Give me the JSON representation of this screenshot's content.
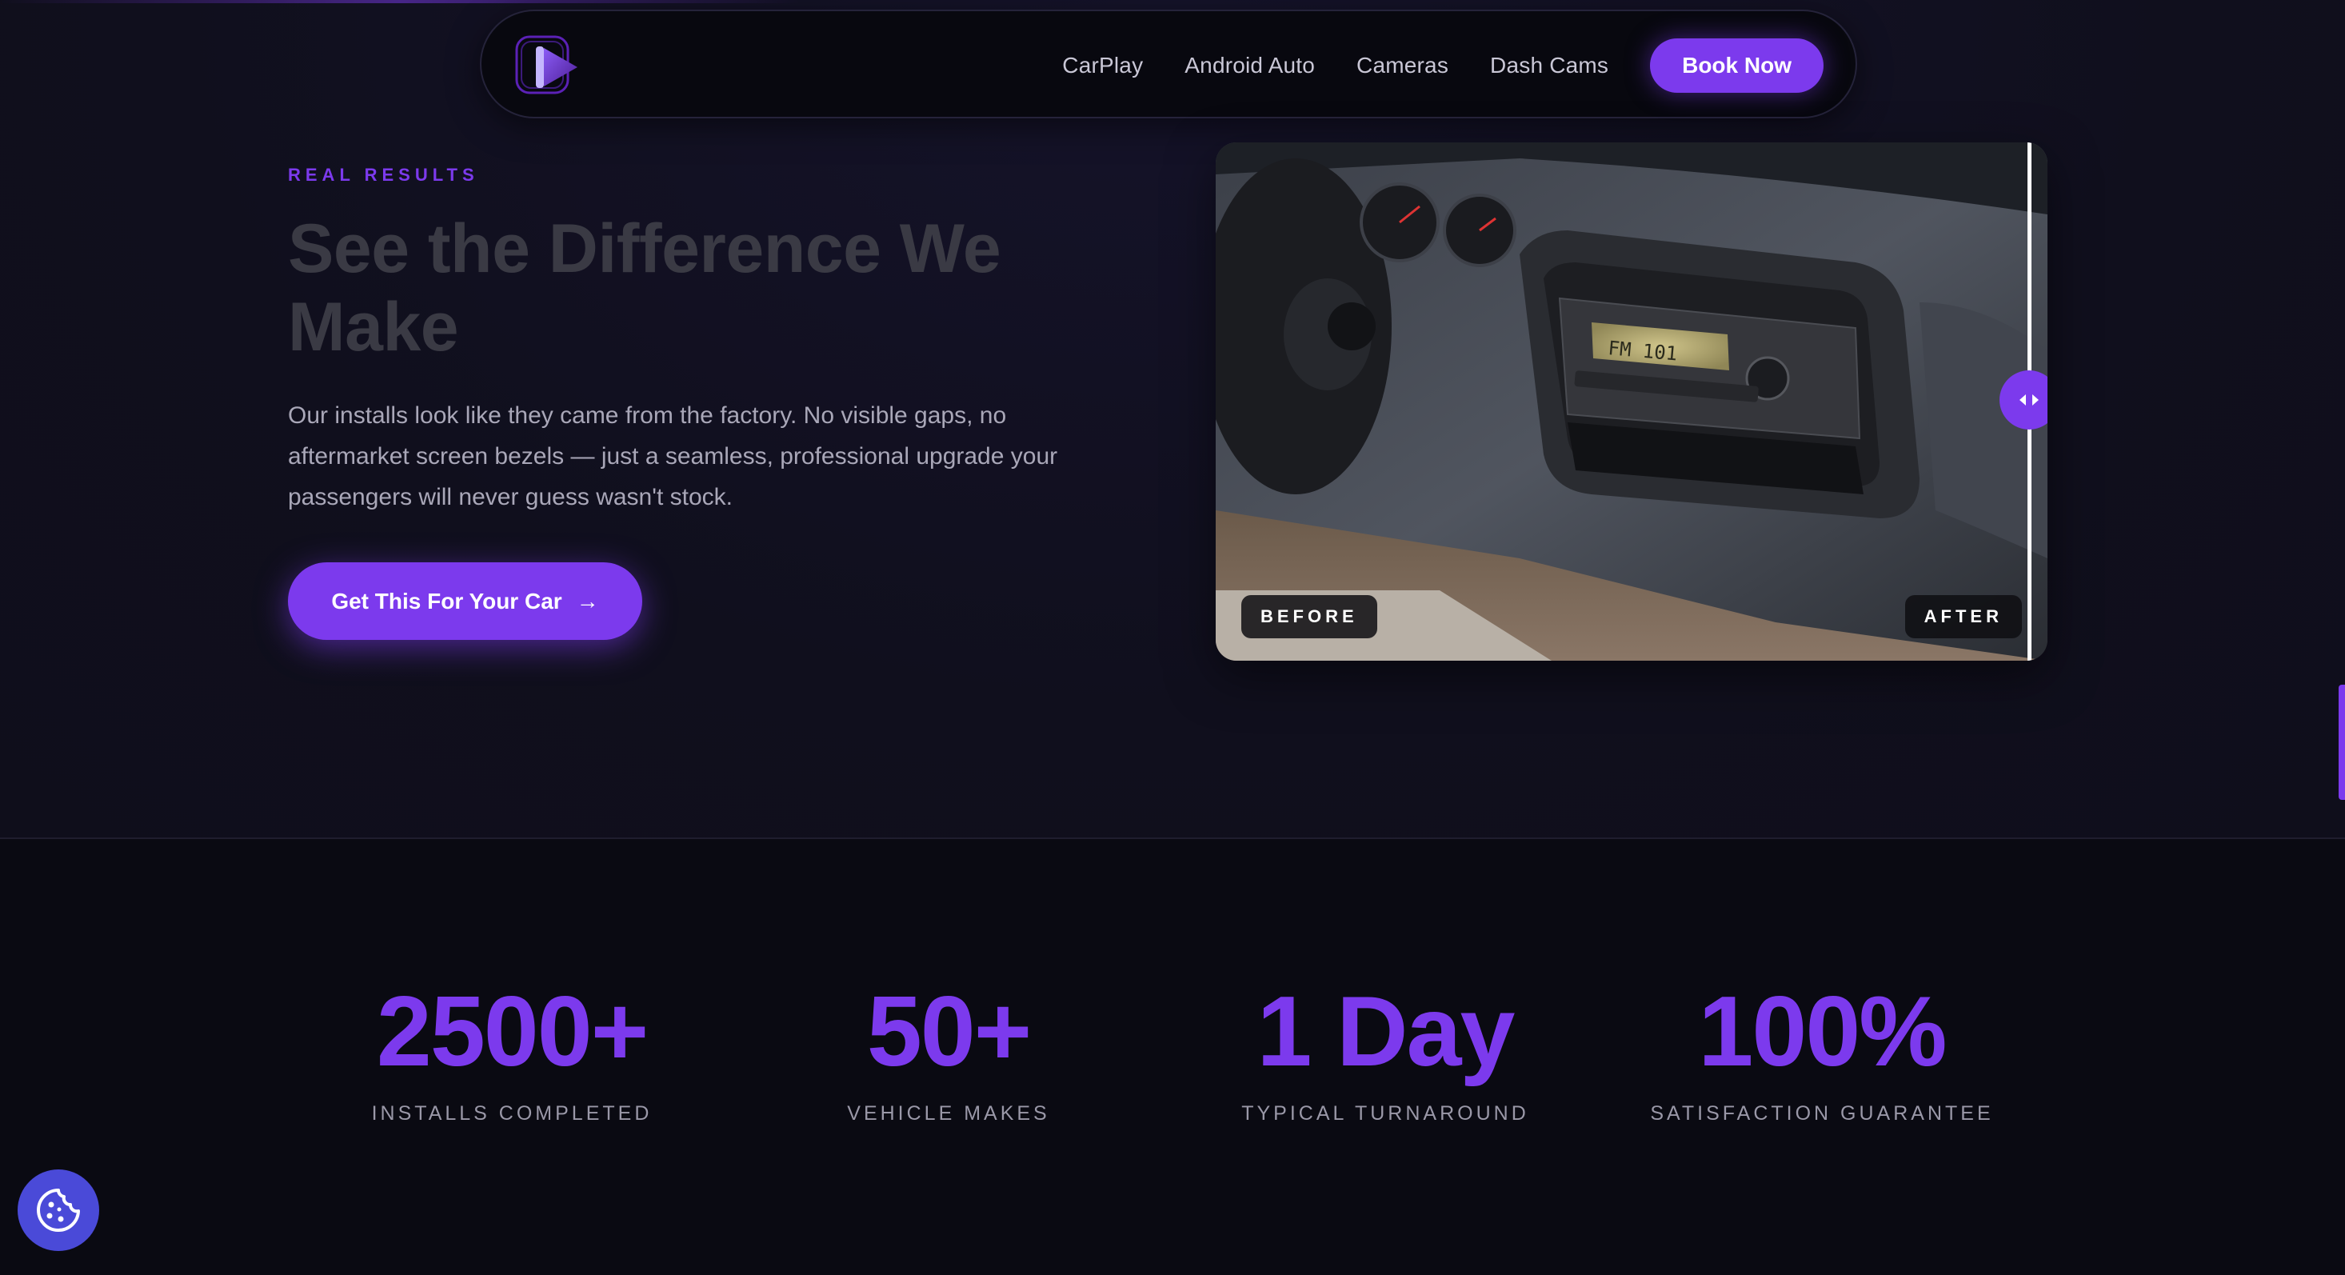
{
  "nav": {
    "links": [
      "CarPlay",
      "Android Auto",
      "Cameras",
      "Dash Cams"
    ],
    "cta": "Book Now"
  },
  "hero": {
    "eyebrow": "REAL RESULTS",
    "headline": "See the Difference We Make",
    "body": "Our installs look like they came from the factory. No visible gaps, no aftermarket screen bezels — just a seamless, professional upgrade your passengers will never guess wasn't stock.",
    "cta": "Get This For Your Car",
    "cta_icon": "arrow-right-icon"
  },
  "comparison": {
    "before_label": "BEFORE",
    "after_label": "AFTER",
    "slider_position": 0.98,
    "radio_display": "FM 101"
  },
  "stats": [
    {
      "value": "2500+",
      "label": "INSTALLS COMPLETED"
    },
    {
      "value": "50+",
      "label": "VEHICLE MAKES"
    },
    {
      "value": "1 Day",
      "label": "TYPICAL TURNAROUND"
    },
    {
      "value": "100%",
      "label": "SATISFACTION GUARANTEE"
    }
  ],
  "colors": {
    "accent": "#7c3aed",
    "background": "#0f0e1b",
    "stats_background": "#0a0a12",
    "cookie_button": "#4a4ad8"
  },
  "icons": {
    "logo": "play-logo-icon",
    "cookie": "cookie-icon",
    "slider_handle": "chevron-left-right-icon"
  }
}
